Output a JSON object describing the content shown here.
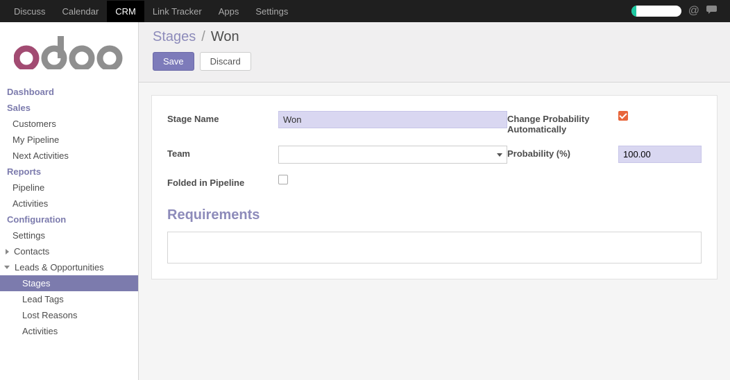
{
  "topnav": {
    "items": [
      "Discuss",
      "Calendar",
      "CRM",
      "Link Tracker",
      "Apps",
      "Settings"
    ],
    "active_index": 2
  },
  "sidebar": {
    "sections": [
      {
        "label": "Dashboard",
        "type": "header"
      },
      {
        "label": "Sales",
        "type": "header"
      },
      {
        "label": "Customers",
        "type": "link"
      },
      {
        "label": "My Pipeline",
        "type": "link"
      },
      {
        "label": "Next Activities",
        "type": "link"
      },
      {
        "label": "Reports",
        "type": "header"
      },
      {
        "label": "Pipeline",
        "type": "link"
      },
      {
        "label": "Activities",
        "type": "link"
      },
      {
        "label": "Configuration",
        "type": "header"
      },
      {
        "label": "Settings",
        "type": "link"
      },
      {
        "label": "Contacts",
        "type": "tree",
        "caret": "right"
      },
      {
        "label": "Leads & Opportunities",
        "type": "tree",
        "caret": "down"
      },
      {
        "label": "Stages",
        "type": "tree-child",
        "active": true
      },
      {
        "label": "Lead Tags",
        "type": "tree-child"
      },
      {
        "label": "Lost Reasons",
        "type": "tree-child"
      },
      {
        "label": "Activities",
        "type": "tree-child"
      }
    ]
  },
  "breadcrumb": {
    "parent": "Stages",
    "current": "Won"
  },
  "buttons": {
    "save": "Save",
    "discard": "Discard"
  },
  "form": {
    "stage_name_label": "Stage Name",
    "stage_name_value": "Won",
    "team_label": "Team",
    "team_value": "",
    "folded_label": "Folded in Pipeline",
    "folded_checked": false,
    "change_prob_label": "Change Probability Automatically",
    "change_prob_checked": true,
    "probability_label": "Probability (%)",
    "probability_value": "100.00",
    "requirements_label": "Requirements",
    "requirements_value": ""
  }
}
